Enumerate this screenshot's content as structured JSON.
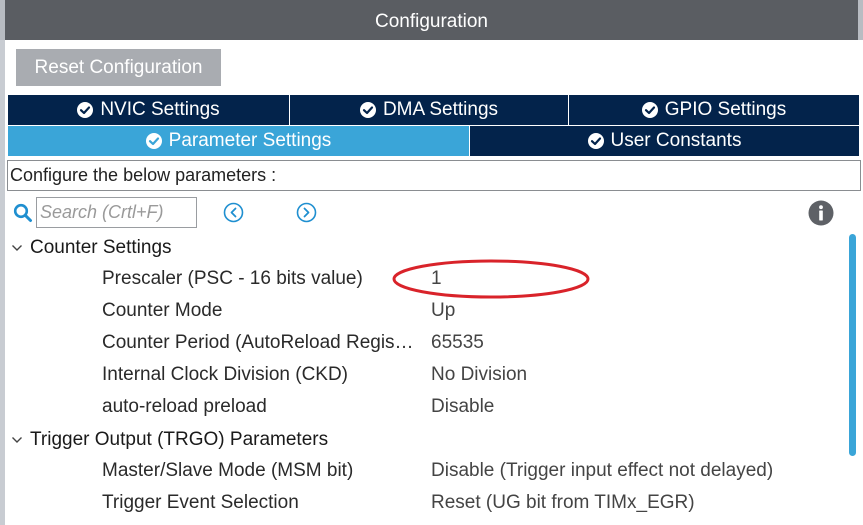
{
  "window": {
    "title": "Configuration"
  },
  "toolbar": {
    "reset_label": "Reset Configuration"
  },
  "tabs": {
    "row1": [
      {
        "label": "NVIC Settings"
      },
      {
        "label": "DMA Settings"
      },
      {
        "label": "GPIO Settings"
      }
    ],
    "row2": [
      {
        "label": "Parameter Settings",
        "active": true
      },
      {
        "label": "User Constants"
      }
    ]
  },
  "description": "Configure the below parameters :",
  "search": {
    "placeholder": "Search (Crtl+F)"
  },
  "groups": [
    {
      "title": "Counter Settings",
      "params": [
        {
          "label": "Prescaler (PSC - 16 bits value)",
          "value": "1"
        },
        {
          "label": "Counter Mode",
          "value": "Up"
        },
        {
          "label": "Counter Period (AutoReload Regis…",
          "value": "65535"
        },
        {
          "label": "Internal Clock Division (CKD)",
          "value": "No Division"
        },
        {
          "label": "auto-reload preload",
          "value": "Disable"
        }
      ]
    },
    {
      "title": "Trigger Output (TRGO) Parameters",
      "params": [
        {
          "label": "Master/Slave Mode (MSM bit)",
          "value": "Disable (Trigger input effect not delayed)"
        },
        {
          "label": "Trigger Event Selection",
          "value": "Reset (UG bit from TIMx_EGR)"
        }
      ]
    }
  ],
  "colors": {
    "tab_dark": "#03234b",
    "tab_active": "#3aa5d8",
    "title_bar": "#5a5d62",
    "highlight": "#d9232a",
    "icon_blue": "#1f8fd0"
  }
}
